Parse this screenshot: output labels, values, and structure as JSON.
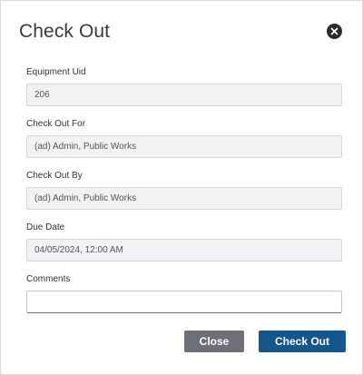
{
  "dialog": {
    "title": "Check Out"
  },
  "fields": {
    "equipment_uid": {
      "label": "Equipment Uid",
      "value": "206"
    },
    "check_out_for": {
      "label": "Check Out For",
      "value": "(ad) Admin, Public Works"
    },
    "check_out_by": {
      "label": "Check Out By",
      "value": "(ad) Admin, Public Works"
    },
    "due_date": {
      "label": "Due Date",
      "value": "04/05/2024, 12:00 AM"
    },
    "comments": {
      "label": "Comments",
      "value": ""
    }
  },
  "buttons": {
    "close_label": "Close",
    "check_out_label": "Check Out"
  },
  "icons": {
    "close": "close-circle-icon"
  },
  "colors": {
    "primary_button": "#14578c",
    "secondary_button": "#6d7079",
    "readonly_field_bg": "#f2f2f5"
  }
}
